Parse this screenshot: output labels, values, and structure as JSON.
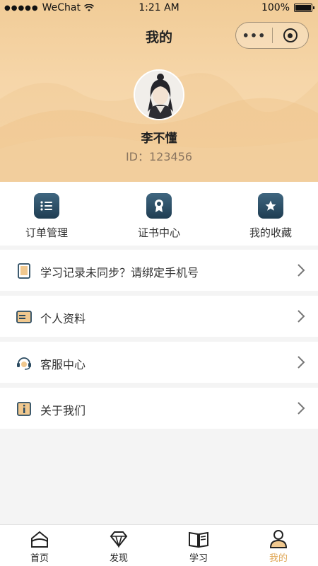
{
  "status_bar": {
    "carrier": "WeChat",
    "time": "1:21 AM",
    "battery": "100%"
  },
  "nav": {
    "title": "我的",
    "more_label": "•••"
  },
  "profile": {
    "name": "李不懂",
    "id_text": "ID：123456"
  },
  "quick_actions": [
    {
      "label": "订单管理",
      "icon": "list-icon"
    },
    {
      "label": "证书中心",
      "icon": "certificate-icon"
    },
    {
      "label": "我的收藏",
      "icon": "star-icon"
    }
  ],
  "menu": [
    {
      "label": "学习记录未同步？请绑定手机号",
      "icon": "phone-icon"
    },
    {
      "label": "个人资料",
      "icon": "id-card-icon"
    },
    {
      "label": "客服中心",
      "icon": "headset-icon"
    },
    {
      "label": "关于我们",
      "icon": "info-icon"
    }
  ],
  "tabs": [
    {
      "label": "首页",
      "icon": "home-icon",
      "active": false
    },
    {
      "label": "发现",
      "icon": "diamond-icon",
      "active": false
    },
    {
      "label": "学习",
      "icon": "book-icon",
      "active": false
    },
    {
      "label": "我的",
      "icon": "user-icon",
      "active": true
    }
  ],
  "colors": {
    "accent": "#e0a95a",
    "header_bg": "#f4d2a2",
    "icon_dark": "#2a4a60"
  }
}
